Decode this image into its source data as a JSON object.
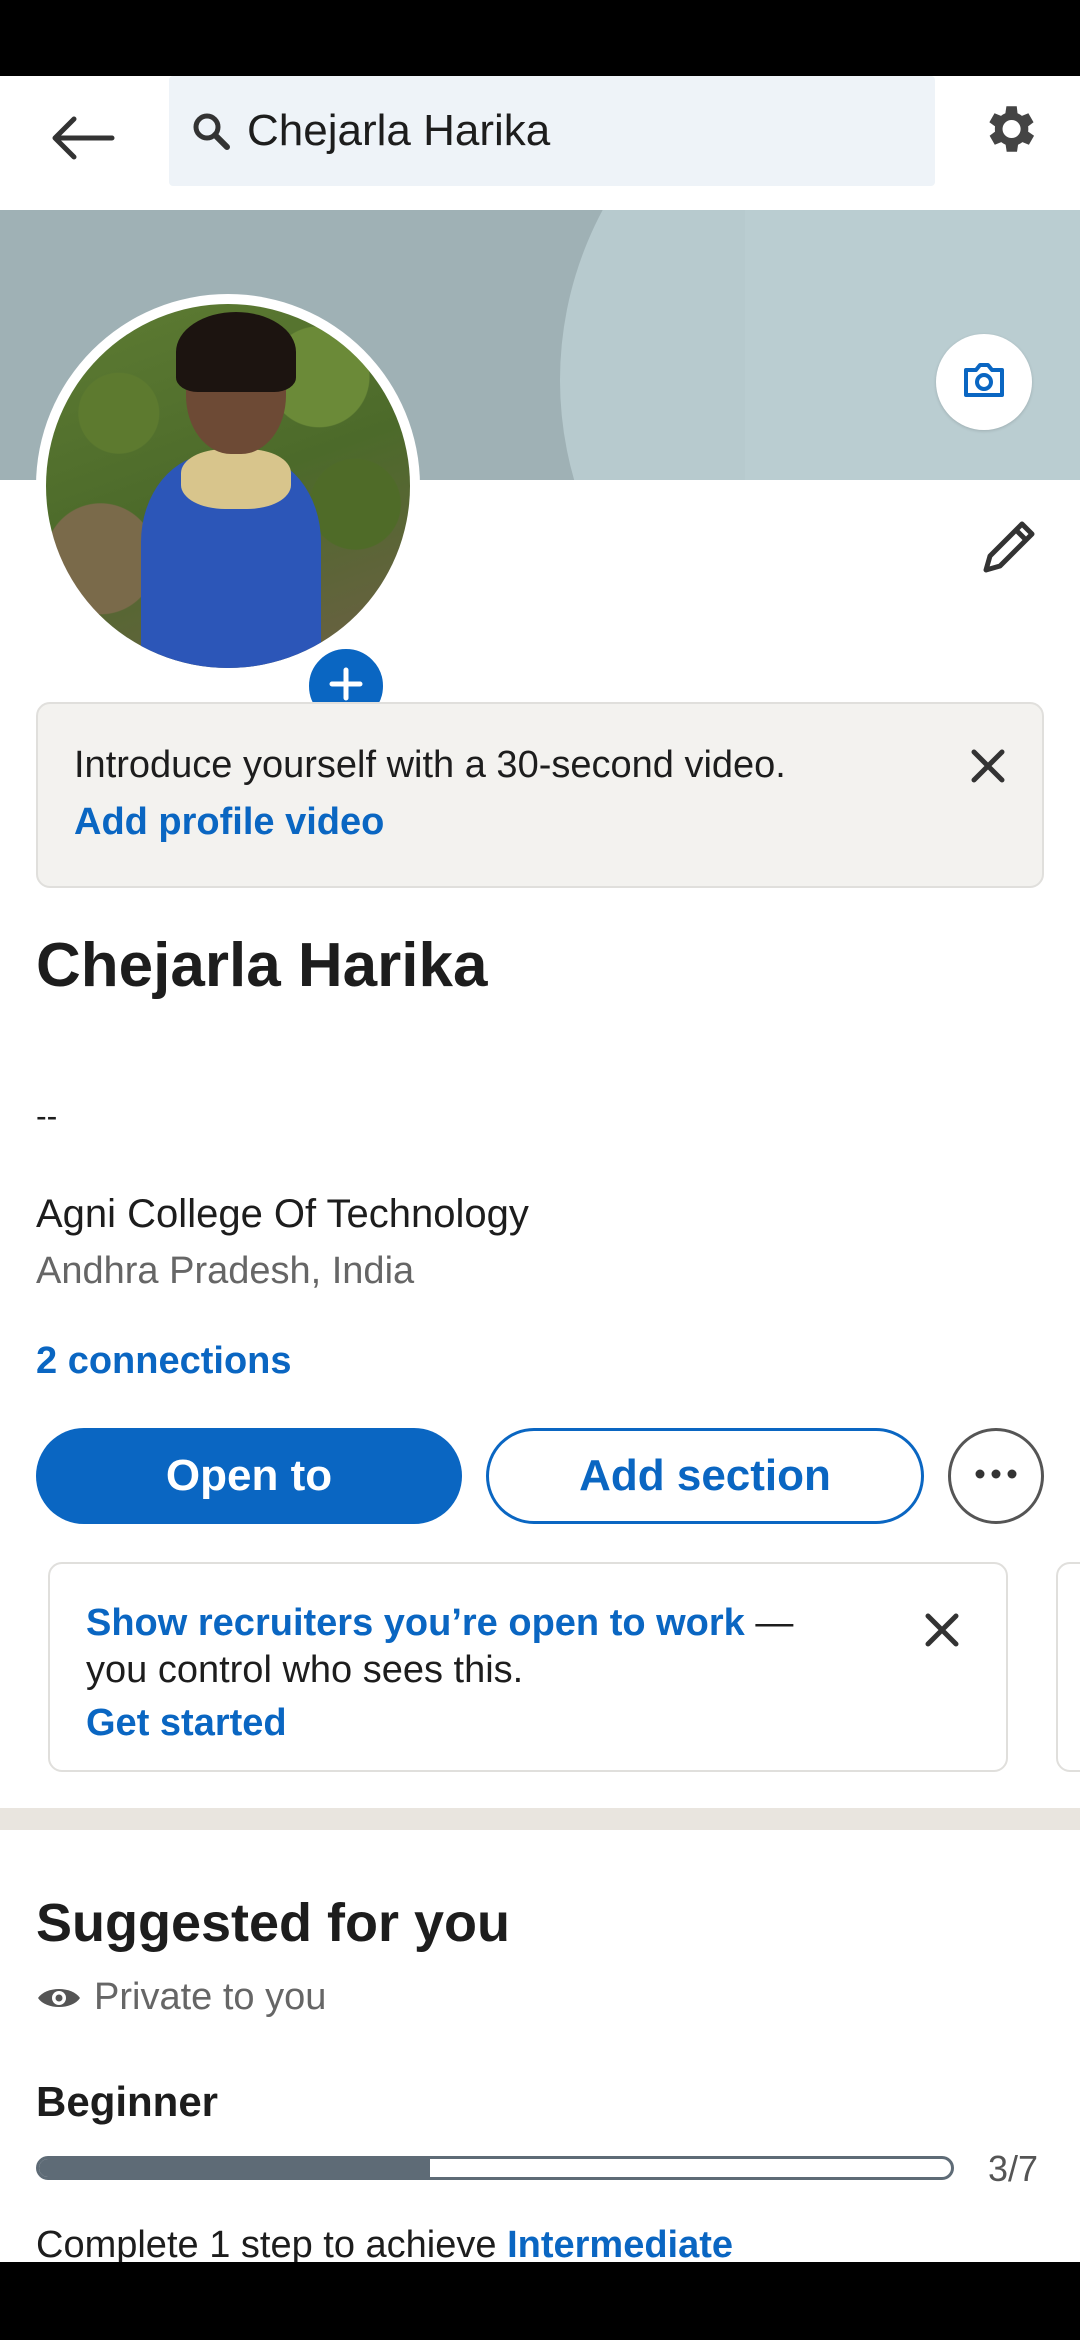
{
  "search": {
    "query": "Chejarla Harika"
  },
  "video_prompt": {
    "text": "Introduce yourself with a 30-second video.",
    "link": "Add profile video"
  },
  "profile": {
    "name": "Chejarla Harika",
    "headline": "--",
    "college": "Agni College Of Technology",
    "location": "Andhra Pradesh, India",
    "connections": "2 connections"
  },
  "actions": {
    "open_to": "Open to",
    "add_section": "Add section"
  },
  "open_to_work": {
    "highlight": "Show recruiters you’re open to work",
    "dash": " —",
    "line2": "you control who sees this.",
    "link": "Get started"
  },
  "suggested": {
    "title": "Suggested for you",
    "privacy": "Private to you",
    "level": "Beginner",
    "progress_text": "3/7",
    "progress_fraction": 0.4286,
    "complete_prefix": "Complete 1 step to achieve ",
    "next_level": "Intermediate"
  },
  "icons": {
    "back": "back-arrow-icon",
    "search": "search-icon",
    "settings": "gear-icon",
    "camera": "camera-icon",
    "add_photo": "plus-icon",
    "edit": "pencil-icon",
    "close": "close-icon",
    "more": "more-dots-icon",
    "privacy": "eye-icon"
  },
  "colors": {
    "accent": "#0a66c2",
    "progress": "#5e6b76"
  }
}
